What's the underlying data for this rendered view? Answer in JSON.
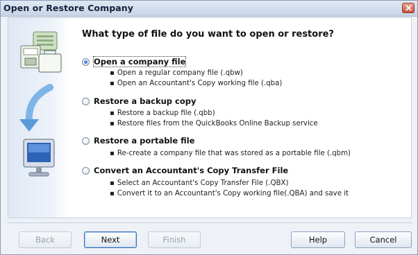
{
  "window": {
    "title": "Open or Restore Company"
  },
  "question": "What type of file do you want to open or restore?",
  "options": [
    {
      "label": "Open a company file",
      "selected": true,
      "bullets": [
        "Open a regular company file (.qbw)",
        "Open an Accountant's Copy working file (.qba)"
      ]
    },
    {
      "label": "Restore a backup copy",
      "selected": false,
      "bullets": [
        "Restore a backup file (.qbb)",
        "Restore files from the QuickBooks Online Backup service"
      ]
    },
    {
      "label": "Restore a portable file",
      "selected": false,
      "bullets": [
        "Re-create a company file that was stored as a portable file (.qbm)"
      ]
    },
    {
      "label": "Convert an Accountant's Copy Transfer File",
      "selected": false,
      "bullets": [
        "Select an Accountant's Copy Transfer File (.QBX)",
        "Convert it to an Accountant's Copy working file(.QBA) and save it"
      ]
    }
  ],
  "buttons": {
    "back": "Back",
    "next": "Next",
    "finish": "Finish",
    "help": "Help",
    "cancel": "Cancel"
  },
  "colors": {
    "accent": "#1b4fb3",
    "close": "#c6533d"
  },
  "icons": [
    "company-files-icon",
    "restore-arrow-icon",
    "computer-monitor-icon",
    "close-icon"
  ]
}
